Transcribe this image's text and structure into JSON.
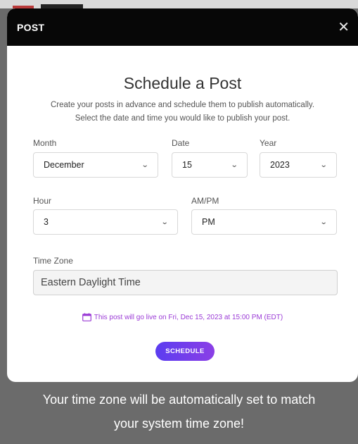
{
  "modal": {
    "header_title": "POST",
    "close_glyph": "✕",
    "heading": "Schedule a Post",
    "subtitle_line1": "Create your posts in advance and schedule them to publish automatically.",
    "subtitle_line2": "Select the date and time you would like to publish your post."
  },
  "fields": {
    "month": {
      "label": "Month",
      "value": "December"
    },
    "date": {
      "label": "Date",
      "value": "15"
    },
    "year": {
      "label": "Year",
      "value": "2023"
    },
    "hour": {
      "label": "Hour",
      "value": "3"
    },
    "ampm": {
      "label": "AM/PM",
      "value": "PM"
    },
    "timezone": {
      "label": "Time Zone",
      "value": "Eastern Daylight Time"
    }
  },
  "notice": {
    "icon": "calendar-icon",
    "text": "This post will go live on Fri, Dec 15, 2023 at 15:00 PM (EDT)",
    "color": "#9b3bd6"
  },
  "button": {
    "label": "SCHEDULE",
    "gradient_start": "#5b3df0",
    "gradient_end": "#8b3fe6"
  },
  "tip": {
    "line1": "Your time zone will be automatically set to match",
    "line2": "your system time zone!"
  }
}
